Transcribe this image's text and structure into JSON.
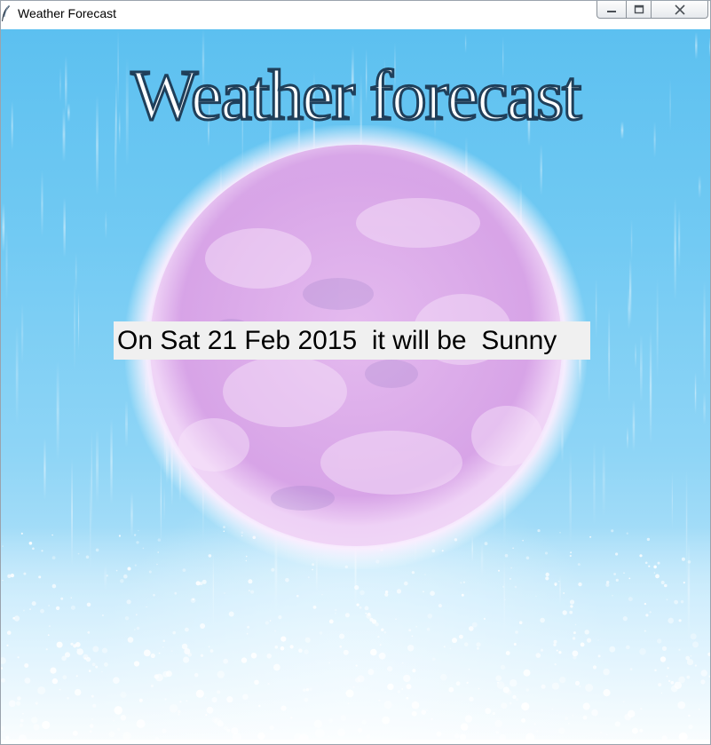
{
  "window": {
    "title": "Weather Forecast",
    "controls": {
      "minimize_icon": "minimize-icon",
      "maximize_icon": "maximize-icon",
      "close_icon": "close-icon"
    }
  },
  "content": {
    "headline": "Weather forecast",
    "forecast_text": "On Sat 21 Feb 2015  it will be  Sunny",
    "background_image": "sun-in-rain"
  },
  "colors": {
    "sky": "#72caf3",
    "headline_stroke": "#1f3f5a",
    "label_background": "#f0f0f0"
  }
}
